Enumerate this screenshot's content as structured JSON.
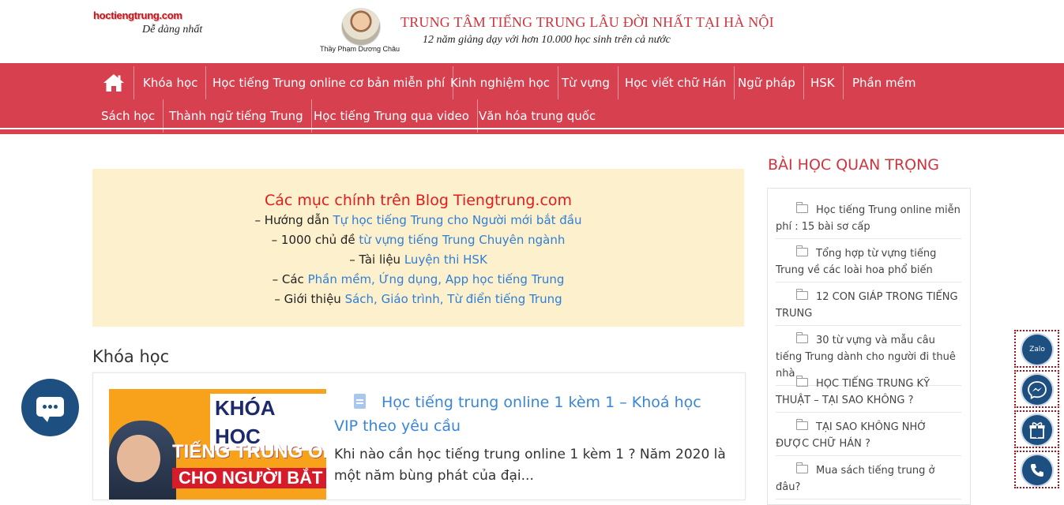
{
  "header": {
    "logo": "hoctiengtrung.com",
    "slogan": "Dễ dàng nhất",
    "teacher_name": "Thầy Phạm Dương Châu",
    "banner_title": "TRUNG TÂM TIẾNG TRUNG LÂU ĐỜI NHẤT TẠI HÀ NỘI",
    "banner_subtitle": "12 năm giảng dạy với hơn 10.000 học sinh trên cả nước"
  },
  "nav": {
    "home_icon": "home-icon",
    "row1": [
      "Khóa học",
      "Học tiếng Trung online cơ bản miễn phí",
      "Kinh nghiệm học",
      "Từ vựng",
      "Học viết chữ Hán",
      "Ngữ pháp",
      "HSK",
      "Phần mềm"
    ],
    "row2": [
      "Sách học",
      "Thành ngữ tiếng Trung",
      "Học tiếng Trung qua video",
      "Văn hóa trung quốc"
    ]
  },
  "notice": {
    "title": "Các mục chính trên Blog Tiengtrung.com",
    "lines": [
      {
        "prefix": "– Hướng dẫn ",
        "link": "Tự học tiếng Trung cho Người mới bắt đầu"
      },
      {
        "prefix": "– 1000 chủ đề ",
        "link": "từ vựng tiếng Trung Chuyên ngành"
      },
      {
        "prefix": "– Tài liệu ",
        "link": "Luyện thi HSK"
      },
      {
        "prefix": "– Các ",
        "link": "Phần mềm, Ứng dụng, App học tiếng Trung"
      },
      {
        "prefix": "– Giới thiệu ",
        "link": "Sách, Giáo trình, Từ điển tiếng Trung"
      }
    ]
  },
  "section": {
    "heading": "Khóa học"
  },
  "post": {
    "thumb_text_1": "KHÓA HỌC",
    "thumb_text_2": "TIẾNG TRUNG ONLINE",
    "thumb_text_3": "CHO NGƯỜI BẮT ĐẦU",
    "title": "Học tiếng trung online 1 kèm 1 – Khoá học VIP theo yêu cầu",
    "excerpt": "Khi nào cần học tiếng trung online 1 kèm 1 ? Năm 2020 là một năm bùng phát của đại..."
  },
  "sidebar": {
    "title": "BÀI HỌC QUAN TRỌNG",
    "items": [
      "Học tiếng Trung online miễn phí : 15 bài sơ cấp",
      "Tổng hợp từ vựng tiếng Trung về các loài hoa phổ biến",
      "12 CON GIÁP TRONG TIẾNG TRUNG",
      "30 từ vựng và mẫu câu tiếng Trung dành cho người đi thuê nhà",
      "HỌC TIẾNG TRUNG KỸ THUẬT – TẠI SAO KHÔNG ?",
      "TẠI SAO KHÔNG NHỚ ĐƯỢC CHỮ HÁN ?",
      "Mua sách tiếng trung ở đâu?"
    ]
  },
  "contact": {
    "zalo_label": "Zalo",
    "icons": [
      "zalo-icon",
      "messenger-icon",
      "gift-icon",
      "phone-icon"
    ]
  },
  "colors": {
    "nav_bg": "#d6404f",
    "accent_red": "#d0343d",
    "link_blue": "#3a86d6",
    "notice_bg": "#fdf0cd",
    "contact_blue": "#1d4f80"
  }
}
